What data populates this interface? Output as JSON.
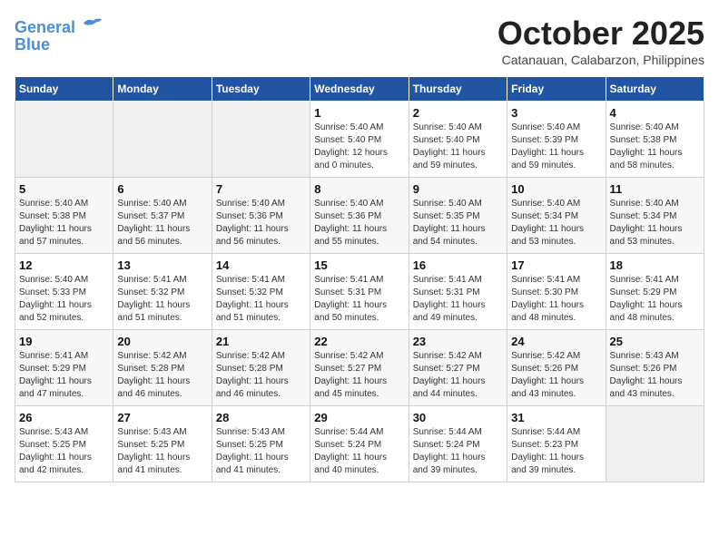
{
  "header": {
    "logo_line1": "General",
    "logo_line2": "Blue",
    "month_title": "October 2025",
    "subtitle": "Catanauan, Calabarzon, Philippines"
  },
  "weekdays": [
    "Sunday",
    "Monday",
    "Tuesday",
    "Wednesday",
    "Thursday",
    "Friday",
    "Saturday"
  ],
  "weeks": [
    [
      {
        "day": "",
        "info": ""
      },
      {
        "day": "",
        "info": ""
      },
      {
        "day": "",
        "info": ""
      },
      {
        "day": "1",
        "info": "Sunrise: 5:40 AM\nSunset: 5:40 PM\nDaylight: 12 hours\nand 0 minutes."
      },
      {
        "day": "2",
        "info": "Sunrise: 5:40 AM\nSunset: 5:40 PM\nDaylight: 11 hours\nand 59 minutes."
      },
      {
        "day": "3",
        "info": "Sunrise: 5:40 AM\nSunset: 5:39 PM\nDaylight: 11 hours\nand 59 minutes."
      },
      {
        "day": "4",
        "info": "Sunrise: 5:40 AM\nSunset: 5:38 PM\nDaylight: 11 hours\nand 58 minutes."
      }
    ],
    [
      {
        "day": "5",
        "info": "Sunrise: 5:40 AM\nSunset: 5:38 PM\nDaylight: 11 hours\nand 57 minutes."
      },
      {
        "day": "6",
        "info": "Sunrise: 5:40 AM\nSunset: 5:37 PM\nDaylight: 11 hours\nand 56 minutes."
      },
      {
        "day": "7",
        "info": "Sunrise: 5:40 AM\nSunset: 5:36 PM\nDaylight: 11 hours\nand 56 minutes."
      },
      {
        "day": "8",
        "info": "Sunrise: 5:40 AM\nSunset: 5:36 PM\nDaylight: 11 hours\nand 55 minutes."
      },
      {
        "day": "9",
        "info": "Sunrise: 5:40 AM\nSunset: 5:35 PM\nDaylight: 11 hours\nand 54 minutes."
      },
      {
        "day": "10",
        "info": "Sunrise: 5:40 AM\nSunset: 5:34 PM\nDaylight: 11 hours\nand 53 minutes."
      },
      {
        "day": "11",
        "info": "Sunrise: 5:40 AM\nSunset: 5:34 PM\nDaylight: 11 hours\nand 53 minutes."
      }
    ],
    [
      {
        "day": "12",
        "info": "Sunrise: 5:40 AM\nSunset: 5:33 PM\nDaylight: 11 hours\nand 52 minutes."
      },
      {
        "day": "13",
        "info": "Sunrise: 5:41 AM\nSunset: 5:32 PM\nDaylight: 11 hours\nand 51 minutes."
      },
      {
        "day": "14",
        "info": "Sunrise: 5:41 AM\nSunset: 5:32 PM\nDaylight: 11 hours\nand 51 minutes."
      },
      {
        "day": "15",
        "info": "Sunrise: 5:41 AM\nSunset: 5:31 PM\nDaylight: 11 hours\nand 50 minutes."
      },
      {
        "day": "16",
        "info": "Sunrise: 5:41 AM\nSunset: 5:31 PM\nDaylight: 11 hours\nand 49 minutes."
      },
      {
        "day": "17",
        "info": "Sunrise: 5:41 AM\nSunset: 5:30 PM\nDaylight: 11 hours\nand 48 minutes."
      },
      {
        "day": "18",
        "info": "Sunrise: 5:41 AM\nSunset: 5:29 PM\nDaylight: 11 hours\nand 48 minutes."
      }
    ],
    [
      {
        "day": "19",
        "info": "Sunrise: 5:41 AM\nSunset: 5:29 PM\nDaylight: 11 hours\nand 47 minutes."
      },
      {
        "day": "20",
        "info": "Sunrise: 5:42 AM\nSunset: 5:28 PM\nDaylight: 11 hours\nand 46 minutes."
      },
      {
        "day": "21",
        "info": "Sunrise: 5:42 AM\nSunset: 5:28 PM\nDaylight: 11 hours\nand 46 minutes."
      },
      {
        "day": "22",
        "info": "Sunrise: 5:42 AM\nSunset: 5:27 PM\nDaylight: 11 hours\nand 45 minutes."
      },
      {
        "day": "23",
        "info": "Sunrise: 5:42 AM\nSunset: 5:27 PM\nDaylight: 11 hours\nand 44 minutes."
      },
      {
        "day": "24",
        "info": "Sunrise: 5:42 AM\nSunset: 5:26 PM\nDaylight: 11 hours\nand 43 minutes."
      },
      {
        "day": "25",
        "info": "Sunrise: 5:43 AM\nSunset: 5:26 PM\nDaylight: 11 hours\nand 43 minutes."
      }
    ],
    [
      {
        "day": "26",
        "info": "Sunrise: 5:43 AM\nSunset: 5:25 PM\nDaylight: 11 hours\nand 42 minutes."
      },
      {
        "day": "27",
        "info": "Sunrise: 5:43 AM\nSunset: 5:25 PM\nDaylight: 11 hours\nand 41 minutes."
      },
      {
        "day": "28",
        "info": "Sunrise: 5:43 AM\nSunset: 5:25 PM\nDaylight: 11 hours\nand 41 minutes."
      },
      {
        "day": "29",
        "info": "Sunrise: 5:44 AM\nSunset: 5:24 PM\nDaylight: 11 hours\nand 40 minutes."
      },
      {
        "day": "30",
        "info": "Sunrise: 5:44 AM\nSunset: 5:24 PM\nDaylight: 11 hours\nand 39 minutes."
      },
      {
        "day": "31",
        "info": "Sunrise: 5:44 AM\nSunset: 5:23 PM\nDaylight: 11 hours\nand 39 minutes."
      },
      {
        "day": "",
        "info": ""
      }
    ]
  ]
}
